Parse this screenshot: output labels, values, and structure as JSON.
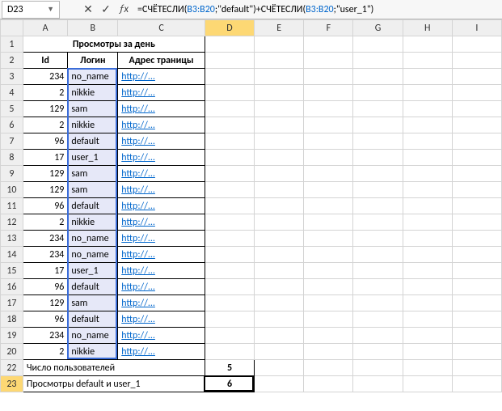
{
  "name_box": "D23",
  "formula": {
    "prefix": "=СЧЁТЕСЛИ(",
    "ref1": "B3:B20",
    "mid1": ";\"default\")+СЧЁТЕСЛИ(",
    "ref2": "B3:B20",
    "suffix": ";\"user_1\")"
  },
  "columns": [
    "A",
    "B",
    "C",
    "D",
    "E",
    "F",
    "G",
    "H",
    "I"
  ],
  "title": "Просмотры за день",
  "headers": {
    "id": "Id",
    "login": "Логин",
    "addr": "Адрес траницы"
  },
  "rows": [
    {
      "n": 3,
      "id": "234",
      "login": "no_name",
      "url": "http://..."
    },
    {
      "n": 4,
      "id": "2",
      "login": "nikkie",
      "url": "http://..."
    },
    {
      "n": 5,
      "id": "129",
      "login": "sam",
      "url": "http://..."
    },
    {
      "n": 6,
      "id": "2",
      "login": "nikkie",
      "url": "http://..."
    },
    {
      "n": 7,
      "id": "96",
      "login": "default",
      "url": "http://..."
    },
    {
      "n": 8,
      "id": "17",
      "login": "user_1",
      "url": "http://..."
    },
    {
      "n": 9,
      "id": "129",
      "login": "sam",
      "url": "http://..."
    },
    {
      "n": 10,
      "id": "129",
      "login": "sam",
      "url": "http://..."
    },
    {
      "n": 11,
      "id": "96",
      "login": "default",
      "url": "http://..."
    },
    {
      "n": 12,
      "id": "2",
      "login": "nikkie",
      "url": "http://..."
    },
    {
      "n": 13,
      "id": "234",
      "login": "no_name",
      "url": "http://..."
    },
    {
      "n": 14,
      "id": "234",
      "login": "no_name",
      "url": "http://..."
    },
    {
      "n": 15,
      "id": "17",
      "login": "user_1",
      "url": "http://..."
    },
    {
      "n": 16,
      "id": "96",
      "login": "default",
      "url": "http://..."
    },
    {
      "n": 17,
      "id": "129",
      "login": "sam",
      "url": "http://..."
    },
    {
      "n": 18,
      "id": "96",
      "login": "default",
      "url": "http://..."
    },
    {
      "n": 19,
      "id": "234",
      "login": "no_name",
      "url": "http://..."
    },
    {
      "n": 20,
      "id": "2",
      "login": "nikkie",
      "url": "http://..."
    }
  ],
  "summary": {
    "users_label": "Число пользователей",
    "users_value": "5",
    "views_label": "Просмотры default и user_1",
    "views_value": "6"
  }
}
